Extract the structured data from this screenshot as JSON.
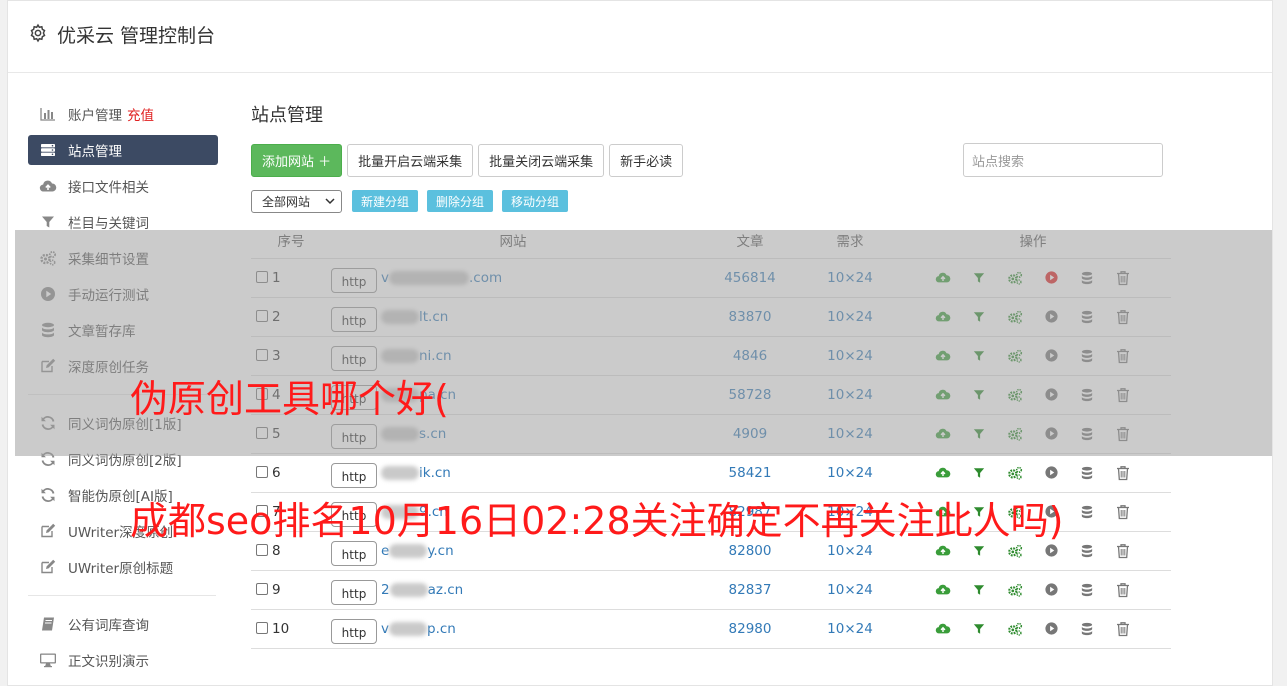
{
  "header": {
    "title": "优采云 管理控制台",
    "icon": "gear-icon"
  },
  "sidebar": {
    "items": [
      {
        "label": "账户管理",
        "extra": "充值",
        "icon": "bar-chart-icon",
        "active": false
      },
      {
        "label": "站点管理",
        "icon": "server-icon",
        "active": true
      },
      {
        "label": "接口文件相关",
        "icon": "cloud-upload-icon",
        "active": false
      },
      {
        "label": "栏目与关键词",
        "icon": "filter-icon",
        "active": false
      },
      {
        "label": "采集细节设置",
        "icon": "cogs-icon",
        "active": false
      },
      {
        "label": "手动运行测试",
        "icon": "play-icon",
        "active": false
      },
      {
        "label": "文章暂存库",
        "icon": "database-icon",
        "active": false
      },
      {
        "label": "深度原创任务",
        "icon": "edit-icon",
        "active": false
      }
    ],
    "items2": [
      {
        "label": "同义词伪原创[1版]",
        "icon": "refresh-icon"
      },
      {
        "label": "同义词伪原创[2版]",
        "icon": "refresh-icon"
      },
      {
        "label": "智能伪原创[AI版]",
        "icon": "refresh-icon"
      },
      {
        "label": "UWriter深度原创",
        "icon": "edit-icon"
      },
      {
        "label": "UWriter原创标题",
        "icon": "edit-icon"
      }
    ],
    "items3": [
      {
        "label": "公有词库查询",
        "icon": "book-icon"
      },
      {
        "label": "正文识别演示",
        "icon": "monitor-icon"
      }
    ]
  },
  "main": {
    "title": "站点管理",
    "buttons": {
      "add": "添加网站 ＋",
      "batch_on": "批量开启云端采集",
      "batch_off": "批量关闭云端采集",
      "guide": "新手必读"
    },
    "search_placeholder": "站点搜索",
    "group_select": "全部网站",
    "group_buttons": {
      "new": "新建分组",
      "delete": "删除分组",
      "move": "移动分组"
    },
    "table": {
      "headers": {
        "num": "序号",
        "site": "网站",
        "articles": "文章",
        "req": "需求",
        "ops": "操作"
      },
      "rows": [
        {
          "num": "1",
          "tag": "http",
          "prefix": "v",
          "suffix": ".com",
          "articles": "456814",
          "req": "10×24",
          "play_active": true
        },
        {
          "num": "2",
          "tag": "http",
          "prefix": "",
          "suffix": "lt.cn",
          "articles": "83870",
          "req": "10×24",
          "play_active": false
        },
        {
          "num": "3",
          "tag": "http",
          "prefix": "",
          "suffix": "ni.cn",
          "articles": "4846",
          "req": "10×24",
          "play_active": false
        },
        {
          "num": "4",
          "tag": "http",
          "prefix": "",
          "suffix": "pa.cn",
          "articles": "58728",
          "req": "10×24",
          "play_active": false
        },
        {
          "num": "5",
          "tag": "http",
          "prefix": "",
          "suffix": "s.cn",
          "articles": "4909",
          "req": "10×24",
          "play_active": false
        },
        {
          "num": "6",
          "tag": "http",
          "prefix": "",
          "suffix": "ik.cn",
          "articles": "58421",
          "req": "10×24",
          "play_active": false
        },
        {
          "num": "7",
          "tag": "http",
          "prefix": "",
          "suffix": "9.cn",
          "articles": "82987",
          "req": "10×24",
          "play_active": false
        },
        {
          "num": "8",
          "tag": "http",
          "prefix": "e",
          "suffix": "y.cn",
          "articles": "82800",
          "req": "10×24",
          "play_active": false
        },
        {
          "num": "9",
          "tag": "http",
          "prefix": "2",
          "suffix": "az.cn",
          "articles": "82837",
          "req": "10×24",
          "play_active": false
        },
        {
          "num": "10",
          "tag": "http",
          "prefix": "v",
          "suffix": "p.cn",
          "articles": "82980",
          "req": "10×24",
          "play_active": false
        }
      ]
    }
  },
  "watermark": {
    "line1": "伪原创工具哪个好(",
    "line2": "成都seo排名10月16日02:28关注确定不再关注此人吗)"
  },
  "colors": {
    "active_nav": "#3c4a63",
    "green": "#5cb85c",
    "info": "#5bc0de",
    "link": "#337ab7",
    "red": "#e02020",
    "watermark": "#ff1a1a"
  }
}
